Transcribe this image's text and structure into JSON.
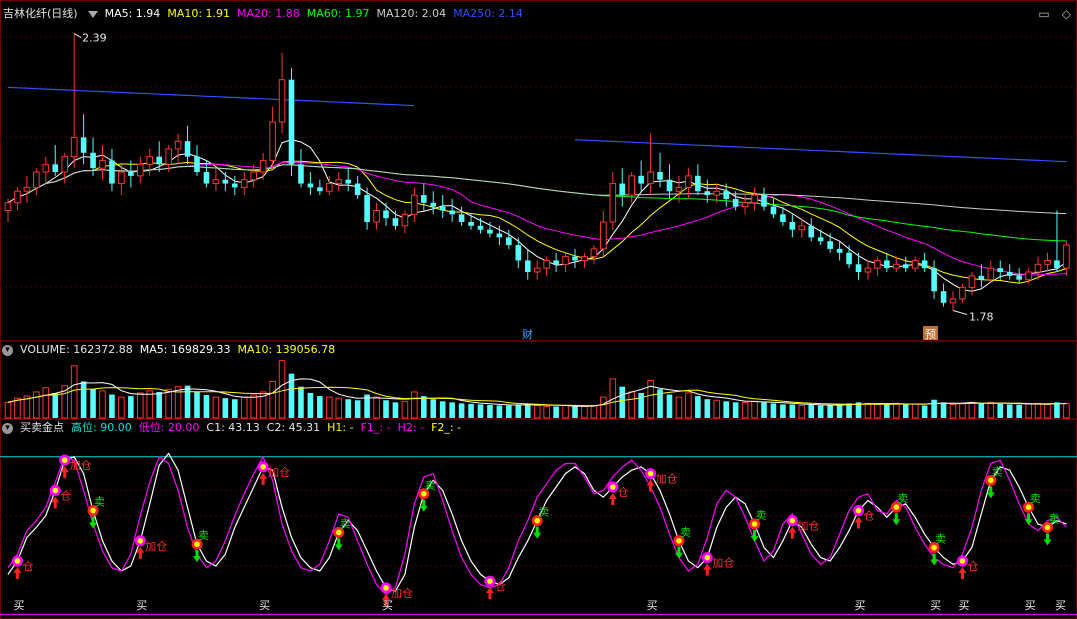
{
  "main_header": {
    "title": "吉林化纤(日线)",
    "ma": [
      {
        "label": "MA5: 1.94",
        "color": "#ffffff"
      },
      {
        "label": "MA10: 1.91",
        "color": "#ffff00"
      },
      {
        "label": "MA20: 1.88",
        "color": "#ff00ff"
      },
      {
        "label": "MA60: 1.97",
        "color": "#00ff00"
      },
      {
        "label": "MA120: 2.04",
        "color": "#cccccc"
      },
      {
        "label": "MA250: 2.14",
        "color": "#3050ff"
      }
    ]
  },
  "vol_header": {
    "title": "VOLUME: 162372.88",
    "ma5": "MA5: 169829.33",
    "ma10": "MA10: 139056.78"
  },
  "ind_header": {
    "title": "买卖金点",
    "gao": "高位: 90.00",
    "di": "低位: 20.00",
    "c1": "C1: 43.13",
    "c2": "C2: 45.31",
    "h1": "H1: -",
    "f1": "F1_: -",
    "h2": "H2: -",
    "f2": "F2_: -"
  },
  "icons": [
    "restore-icon",
    "close-icon"
  ],
  "chart_data": [
    {
      "type": "candlestick",
      "panel": "price",
      "annotations": {
        "high_label": "2.39",
        "low_label": "1.78",
        "cai_label": "财",
        "yu_label": "预"
      },
      "candles": [
        [
          1.93,
          1.96,
          1.9,
          1.95
        ],
        [
          1.95,
          1.99,
          1.93,
          1.98
        ],
        [
          1.98,
          2.02,
          1.95,
          1.99
        ],
        [
          1.99,
          2.04,
          1.97,
          2.03
        ],
        [
          2.03,
          2.07,
          2.0,
          2.05
        ],
        [
          2.05,
          2.1,
          2.02,
          2.03
        ],
        [
          2.03,
          2.08,
          2.0,
          2.07
        ],
        [
          2.07,
          2.39,
          2.04,
          2.12
        ],
        [
          2.12,
          2.18,
          2.05,
          2.08
        ],
        [
          2.08,
          2.12,
          2.02,
          2.04
        ],
        [
          2.04,
          2.1,
          2.01,
          2.06
        ],
        [
          2.06,
          2.09,
          1.98,
          2.0
        ],
        [
          2.0,
          2.05,
          1.97,
          2.03
        ],
        [
          2.03,
          2.06,
          1.99,
          2.02
        ],
        [
          2.02,
          2.07,
          2.0,
          2.05
        ],
        [
          2.05,
          2.09,
          2.02,
          2.07
        ],
        [
          2.07,
          2.11,
          2.03,
          2.05
        ],
        [
          2.05,
          2.1,
          2.03,
          2.09
        ],
        [
          2.09,
          2.13,
          2.05,
          2.11
        ],
        [
          2.11,
          2.15,
          2.05,
          2.07
        ],
        [
          2.07,
          2.1,
          2.02,
          2.03
        ],
        [
          2.03,
          2.06,
          1.99,
          2.0
        ],
        [
          2.0,
          2.04,
          1.98,
          2.01
        ],
        [
          2.01,
          2.03,
          1.98,
          2.0
        ],
        [
          2.0,
          2.02,
          1.97,
          1.99
        ],
        [
          1.99,
          2.03,
          1.97,
          2.01
        ],
        [
          2.01,
          2.05,
          1.99,
          2.03
        ],
        [
          2.03,
          2.08,
          2.01,
          2.06
        ],
        [
          2.06,
          2.2,
          2.04,
          2.16
        ],
        [
          2.16,
          2.34,
          2.13,
          2.27
        ],
        [
          2.27,
          2.3,
          2.02,
          2.05
        ],
        [
          2.05,
          2.09,
          1.99,
          2.0
        ],
        [
          2.0,
          2.03,
          1.97,
          1.99
        ],
        [
          1.99,
          2.01,
          1.97,
          1.98
        ],
        [
          1.98,
          2.02,
          1.97,
          2.0
        ],
        [
          2.0,
          2.03,
          1.98,
          2.01
        ],
        [
          2.01,
          2.04,
          1.98,
          2.0
        ],
        [
          2.0,
          2.02,
          1.96,
          1.97
        ],
        [
          1.97,
          1.99,
          1.88,
          1.9
        ],
        [
          1.9,
          1.95,
          1.88,
          1.93
        ],
        [
          1.93,
          1.95,
          1.89,
          1.91
        ],
        [
          1.91,
          1.93,
          1.88,
          1.89
        ],
        [
          1.89,
          1.93,
          1.87,
          1.92
        ],
        [
          1.92,
          1.99,
          1.9,
          1.97
        ],
        [
          1.97,
          2.0,
          1.93,
          1.95
        ],
        [
          1.95,
          1.98,
          1.92,
          1.94
        ],
        [
          1.94,
          1.97,
          1.91,
          1.93
        ],
        [
          1.93,
          1.96,
          1.9,
          1.92
        ],
        [
          1.92,
          1.94,
          1.89,
          1.9
        ],
        [
          1.9,
          1.92,
          1.88,
          1.89
        ],
        [
          1.89,
          1.91,
          1.87,
          1.88
        ],
        [
          1.88,
          1.9,
          1.86,
          1.87
        ],
        [
          1.87,
          1.89,
          1.84,
          1.86
        ],
        [
          1.86,
          1.88,
          1.83,
          1.84
        ],
        [
          1.84,
          1.86,
          1.78,
          1.8
        ],
        [
          1.8,
          1.83,
          1.75,
          1.77
        ],
        [
          1.77,
          1.8,
          1.75,
          1.78
        ],
        [
          1.78,
          1.81,
          1.76,
          1.8
        ],
        [
          1.8,
          1.82,
          1.77,
          1.79
        ],
        [
          1.79,
          1.82,
          1.77,
          1.81
        ],
        [
          1.81,
          1.83,
          1.78,
          1.8
        ],
        [
          1.8,
          1.82,
          1.78,
          1.81
        ],
        [
          1.81,
          1.84,
          1.79,
          1.83
        ],
        [
          1.83,
          1.93,
          1.81,
          1.9
        ],
        [
          1.9,
          2.03,
          1.88,
          2.0
        ],
        [
          2.0,
          2.04,
          1.94,
          1.97
        ],
        [
          1.97,
          2.03,
          1.95,
          2.02
        ],
        [
          2.02,
          2.06,
          1.98,
          2.0
        ],
        [
          2.0,
          2.13,
          1.97,
          2.03
        ],
        [
          2.03,
          2.08,
          1.99,
          2.01
        ],
        [
          2.01,
          2.05,
          1.96,
          1.98
        ],
        [
          1.98,
          2.02,
          1.95,
          1.99
        ],
        [
          1.99,
          2.04,
          1.96,
          2.02
        ],
        [
          2.02,
          2.05,
          1.97,
          1.98
        ],
        [
          1.98,
          2.01,
          1.95,
          1.97
        ],
        [
          1.97,
          2.0,
          1.95,
          1.98
        ],
        [
          1.98,
          2.0,
          1.94,
          1.96
        ],
        [
          1.96,
          1.98,
          1.93,
          1.94
        ],
        [
          1.94,
          1.97,
          1.92,
          1.95
        ],
        [
          1.95,
          1.99,
          1.93,
          1.97
        ],
        [
          1.97,
          1.99,
          1.93,
          1.94
        ],
        [
          1.94,
          1.96,
          1.91,
          1.92
        ],
        [
          1.92,
          1.94,
          1.89,
          1.9
        ],
        [
          1.9,
          1.92,
          1.86,
          1.88
        ],
        [
          1.88,
          1.91,
          1.86,
          1.89
        ],
        [
          1.89,
          1.91,
          1.85,
          1.86
        ],
        [
          1.86,
          1.88,
          1.84,
          1.85
        ],
        [
          1.85,
          1.87,
          1.82,
          1.83
        ],
        [
          1.83,
          1.85,
          1.8,
          1.82
        ],
        [
          1.82,
          1.84,
          1.78,
          1.79
        ],
        [
          1.79,
          1.82,
          1.75,
          1.77
        ],
        [
          1.77,
          1.8,
          1.75,
          1.78
        ],
        [
          1.78,
          1.81,
          1.76,
          1.8
        ],
        [
          1.8,
          1.82,
          1.77,
          1.78
        ],
        [
          1.78,
          1.81,
          1.77,
          1.79
        ],
        [
          1.79,
          1.81,
          1.77,
          1.78
        ],
        [
          1.78,
          1.81,
          1.77,
          1.8
        ],
        [
          1.8,
          1.82,
          1.77,
          1.78
        ],
        [
          1.78,
          1.8,
          1.7,
          1.72
        ],
        [
          1.72,
          1.74,
          1.68,
          1.69
        ],
        [
          1.69,
          1.72,
          1.67,
          1.7
        ],
        [
          1.7,
          1.74,
          1.69,
          1.73
        ],
        [
          1.73,
          1.77,
          1.71,
          1.76
        ],
        [
          1.76,
          1.79,
          1.73,
          1.75
        ],
        [
          1.75,
          1.8,
          1.74,
          1.78
        ],
        [
          1.78,
          1.8,
          1.75,
          1.77
        ],
        [
          1.77,
          1.79,
          1.75,
          1.76
        ],
        [
          1.76,
          1.78,
          1.74,
          1.75
        ],
        [
          1.75,
          1.78,
          1.74,
          1.77
        ],
        [
          1.77,
          1.81,
          1.75,
          1.79
        ],
        [
          1.79,
          1.82,
          1.77,
          1.8
        ],
        [
          1.8,
          1.93,
          1.77,
          1.78
        ],
        [
          1.78,
          1.85,
          1.76,
          1.84
        ]
      ],
      "ylim": [
        1.64,
        2.42
      ]
    },
    {
      "type": "bar",
      "panel": "volume",
      "values": [
        30,
        38,
        42,
        50,
        58,
        48,
        62,
        100,
        70,
        55,
        52,
        45,
        40,
        42,
        48,
        52,
        50,
        55,
        60,
        62,
        50,
        44,
        40,
        38,
        36,
        40,
        44,
        50,
        70,
        110,
        85,
        60,
        48,
        42,
        40,
        38,
        36,
        34,
        45,
        40,
        34,
        30,
        32,
        50,
        42,
        36,
        32,
        30,
        28,
        27,
        26,
        25,
        24,
        24,
        26,
        28,
        24,
        22,
        22,
        24,
        22,
        22,
        24,
        40,
        75,
        60,
        50,
        48,
        72,
        55,
        45,
        40,
        48,
        42,
        36,
        34,
        32,
        30,
        30,
        32,
        30,
        28,
        26,
        26,
        24,
        26,
        24,
        24,
        26,
        28,
        30,
        28,
        26,
        26,
        28,
        26,
        27,
        24,
        35,
        30,
        26,
        28,
        30,
        28,
        30,
        27,
        26,
        25,
        27,
        28,
        26,
        30,
        28
      ],
      "ma5_color": "#ffffff",
      "ma10_color": "#ffff00",
      "ylim": [
        0,
        115
      ]
    },
    {
      "type": "line",
      "panel": "indicator",
      "series": [
        {
          "values": [
            20,
            28,
            42,
            48,
            55,
            70,
            88,
            90,
            80,
            58,
            40,
            28,
            22,
            25,
            40,
            62,
            85,
            92,
            82,
            60,
            38,
            28,
            25,
            32,
            48,
            60,
            72,
            84,
            82,
            60,
            42,
            30,
            24,
            22,
            30,
            45,
            52,
            46,
            34,
            22,
            12,
            10,
            20,
            48,
            68,
            76,
            70,
            56,
            40,
            28,
            20,
            16,
            14,
            18,
            30,
            40,
            52,
            64,
            72,
            80,
            84,
            80,
            70,
            66,
            72,
            78,
            82,
            84,
            80,
            70,
            56,
            40,
            28,
            24,
            30,
            48,
            60,
            66,
            62,
            50,
            36,
            30,
            40,
            52,
            48,
            38,
            30,
            28,
            36,
            46,
            58,
            64,
            60,
            54,
            60,
            62,
            54,
            44,
            36,
            30,
            26,
            28,
            36,
            56,
            76,
            84,
            82,
            72,
            60,
            50,
            48,
            52,
            50
          ],
          "color": "#ffffff"
        },
        {
          "values": [
            24,
            32,
            46,
            52,
            60,
            75,
            90,
            88,
            70,
            50,
            34,
            24,
            22,
            32,
            55,
            75,
            90,
            86,
            70,
            48,
            32,
            24,
            28,
            40,
            55,
            68,
            80,
            90,
            76,
            50,
            34,
            24,
            22,
            26,
            40,
            56,
            54,
            40,
            26,
            14,
            8,
            12,
            32,
            62,
            78,
            80,
            64,
            46,
            30,
            20,
            14,
            12,
            14,
            24,
            40,
            52,
            66,
            74,
            82,
            86,
            86,
            78,
            68,
            70,
            78,
            84,
            88,
            82,
            72,
            60,
            44,
            30,
            22,
            26,
            42,
            62,
            70,
            66,
            54,
            40,
            28,
            34,
            50,
            56,
            44,
            32,
            26,
            30,
            44,
            58,
            66,
            68,
            58,
            56,
            64,
            60,
            48,
            38,
            30,
            26,
            24,
            32,
            48,
            70,
            86,
            88,
            76,
            62,
            50,
            46,
            52,
            54,
            48
          ],
          "color": "#ff00ff"
        }
      ],
      "gao": 90,
      "di": 20,
      "ylim": [
        0,
        100
      ],
      "signals": [
        {
          "i": 1,
          "label": "仓",
          "kind": "buy"
        },
        {
          "i": 5,
          "label": "仓",
          "kind": "buy"
        },
        {
          "i": 6,
          "label": "加仓",
          "kind": "buy"
        },
        {
          "i": 9,
          "label": "卖",
          "kind": "sell"
        },
        {
          "i": 14,
          "label": "加仓",
          "kind": "buy"
        },
        {
          "i": 20,
          "label": "卖",
          "kind": "sell"
        },
        {
          "i": 27,
          "label": "加仓",
          "kind": "buy"
        },
        {
          "i": 35,
          "label": "卖",
          "kind": "sell"
        },
        {
          "i": 40,
          "label": "加仓",
          "kind": "buy"
        },
        {
          "i": 44,
          "label": "卖",
          "kind": "sell"
        },
        {
          "i": 51,
          "label": "仓",
          "kind": "buy"
        },
        {
          "i": 56,
          "label": "卖",
          "kind": "sell"
        },
        {
          "i": 64,
          "label": "仓",
          "kind": "buy"
        },
        {
          "i": 68,
          "label": "加仓",
          "kind": "buy"
        },
        {
          "i": 71,
          "label": "卖",
          "kind": "sell"
        },
        {
          "i": 74,
          "label": "加仓",
          "kind": "buy"
        },
        {
          "i": 79,
          "label": "卖",
          "kind": "sell"
        },
        {
          "i": 83,
          "label": "加仓",
          "kind": "buy"
        },
        {
          "i": 90,
          "label": "仓",
          "kind": "buy"
        },
        {
          "i": 94,
          "label": "卖",
          "kind": "sell"
        },
        {
          "i": 98,
          "label": "卖",
          "kind": "sell"
        },
        {
          "i": 101,
          "label": "仓",
          "kind": "buy"
        },
        {
          "i": 104,
          "label": "卖",
          "kind": "sell"
        },
        {
          "i": 108,
          "label": "卖",
          "kind": "sell"
        },
        {
          "i": 110,
          "label": "卖",
          "kind": "sell"
        }
      ],
      "bottom_labels": [
        {
          "i": 1,
          "label": "买"
        },
        {
          "i": 14,
          "label": "买"
        },
        {
          "i": 27,
          "label": "买"
        },
        {
          "i": 40,
          "label": "买"
        },
        {
          "i": 68,
          "label": "买"
        },
        {
          "i": 90,
          "label": "买"
        },
        {
          "i": 98,
          "label": "买"
        },
        {
          "i": 101,
          "label": "买"
        },
        {
          "i": 108,
          "label": "买"
        },
        {
          "i": 121,
          "label": "买"
        }
      ]
    }
  ]
}
